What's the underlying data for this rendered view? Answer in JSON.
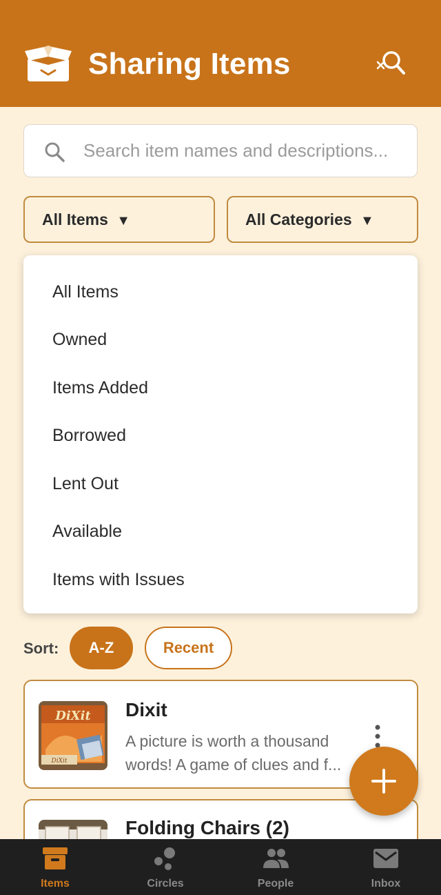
{
  "header": {
    "title": "Sharing Items",
    "logo_icon": "box-open-icon",
    "search_icon": "search-clear-icon"
  },
  "search": {
    "value": "",
    "placeholder": "Search item names and descriptions..."
  },
  "filters": {
    "items_label": "All Items",
    "categories_label": "All Categories",
    "caret": "▼"
  },
  "dropdown": {
    "options": [
      "All Items",
      "Owned",
      "Items Added",
      "Borrowed",
      "Lent Out",
      "Available",
      "Items with Issues"
    ]
  },
  "sort": {
    "label": "Sort:",
    "options": [
      "A-Z",
      "Recent"
    ],
    "selected": "A-Z"
  },
  "items": [
    {
      "name": "Dixit",
      "description_lines": [
        "A picture is worth a thousand",
        "words! A game of clues and f..."
      ]
    },
    {
      "name": "Folding Chairs (2)",
      "description_lines": []
    }
  ],
  "nav": {
    "items": [
      {
        "label": "Items",
        "icon": "archive-icon",
        "active": true
      },
      {
        "label": "Circles",
        "icon": "circles-icon",
        "active": false
      },
      {
        "label": "People",
        "icon": "people-icon",
        "active": false
      },
      {
        "label": "Inbox",
        "icon": "mail-icon",
        "active": false
      }
    ]
  },
  "colors": {
    "primary": "#c8731a",
    "background": "#fdf1dc",
    "nav_background": "#1f1f1f",
    "card_border": "#c08a3e"
  }
}
